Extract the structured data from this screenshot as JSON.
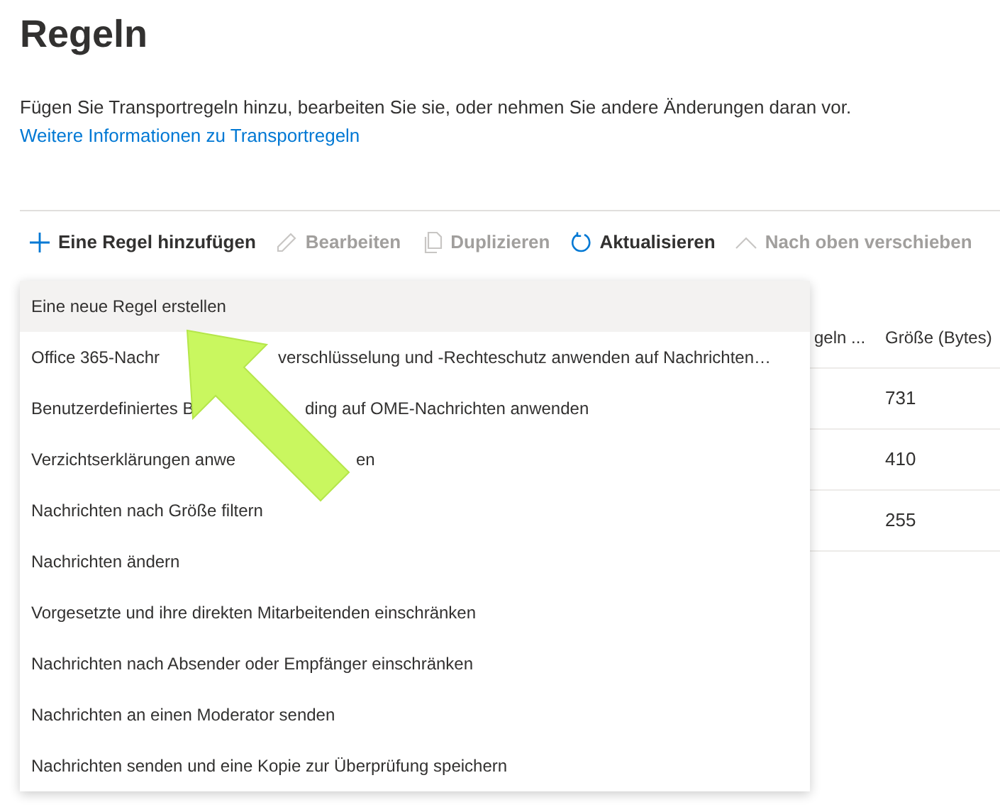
{
  "page": {
    "title": "Regeln",
    "description": "Fügen Sie Transportregeln hinzu, bearbeiten Sie sie, oder nehmen Sie andere Änderungen daran vor.",
    "link": "Weitere Informationen zu Transportregeln"
  },
  "toolbar": [
    {
      "label": "Eine Regel hinzufügen",
      "disabled": false
    },
    {
      "label": "Bearbeiten",
      "disabled": true
    },
    {
      "label": "Duplizieren",
      "disabled": true
    },
    {
      "label": "Aktualisieren",
      "disabled": false
    },
    {
      "label": "Nach oben verschieben",
      "disabled": true
    }
  ],
  "menu": [
    {
      "parts": [
        "Eine neue Regel erstellen"
      ],
      "selected": true
    },
    {
      "parts": [
        "Office 365-Nachr",
        "verschlüsselung und -Rechteschutz anwenden auf Nachrichten…"
      ],
      "selected": false
    },
    {
      "parts": [
        "Benutzerdefiniertes B",
        "ding auf OME-Nachrichten anwenden"
      ],
      "selected": false
    },
    {
      "parts": [
        "Verzichtserklärungen anwe",
        "en"
      ],
      "selected": false
    },
    {
      "parts": [
        "Nachrichten nach Größe filtern"
      ],
      "selected": false
    },
    {
      "parts": [
        "Nachrichten ändern"
      ],
      "selected": false
    },
    {
      "parts": [
        "Vorgesetzte und ihre direkten Mitarbeitenden einschränken"
      ],
      "selected": false
    },
    {
      "parts": [
        "Nachrichten nach Absender oder Empfänger einschränken"
      ],
      "selected": false
    },
    {
      "parts": [
        "Nachrichten an einen Moderator senden"
      ],
      "selected": false
    },
    {
      "parts": [
        "Nachrichten senden und eine Kopie zur Überprüfung speichern"
      ],
      "selected": false
    }
  ],
  "table": {
    "columns": [
      "geln ...",
      "Größe (Bytes)"
    ],
    "rows": [
      [
        "731"
      ],
      [
        "410"
      ],
      [
        "255"
      ]
    ]
  }
}
